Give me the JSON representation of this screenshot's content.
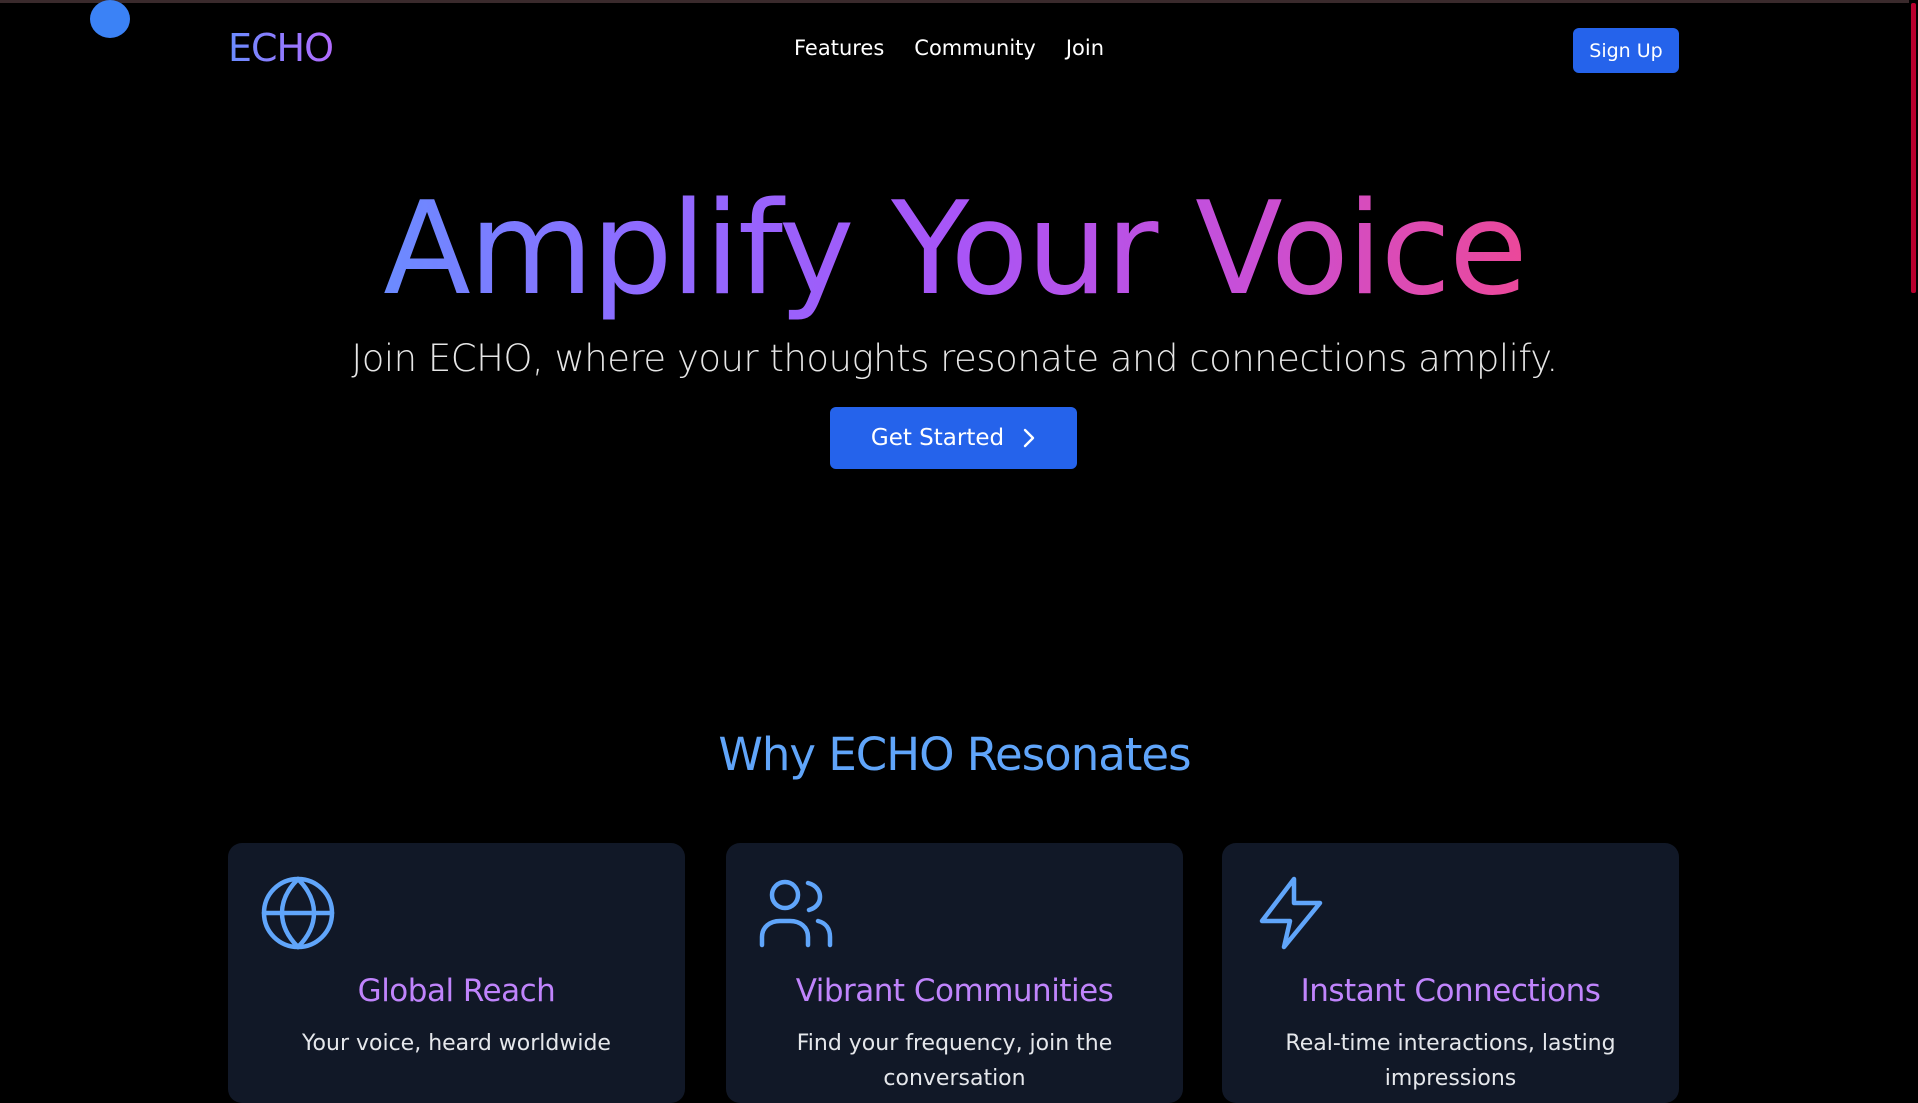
{
  "nav": {
    "logo": "ECHO",
    "links": [
      "Features",
      "Community",
      "Join"
    ],
    "signup_label": "Sign Up"
  },
  "hero": {
    "title": "Amplify Your Voice",
    "subtitle": "Join ECHO, where your thoughts resonate and connections amplify.",
    "cta_label": "Get Started",
    "cta_icon": "chevron-right-icon"
  },
  "features": {
    "title": "Why ECHO Resonates",
    "cards": [
      {
        "icon": "globe-icon",
        "title": "Global Reach",
        "text": "Your voice, heard worldwide"
      },
      {
        "icon": "users-icon",
        "title": "Vibrant Communities",
        "text": "Find your frequency, join the conversation"
      },
      {
        "icon": "lightning-bolt-icon",
        "title": "Instant Connections",
        "text": "Real-time interactions, lasting impressions"
      }
    ]
  },
  "colors": {
    "background": "#000000",
    "accent_blue": "#2563eb",
    "section_title": "#60a5fa",
    "card_title": "#c084fc",
    "card_bg": "#111827",
    "gradient_start": "#6b8bff",
    "gradient_end": "#ec4899"
  }
}
